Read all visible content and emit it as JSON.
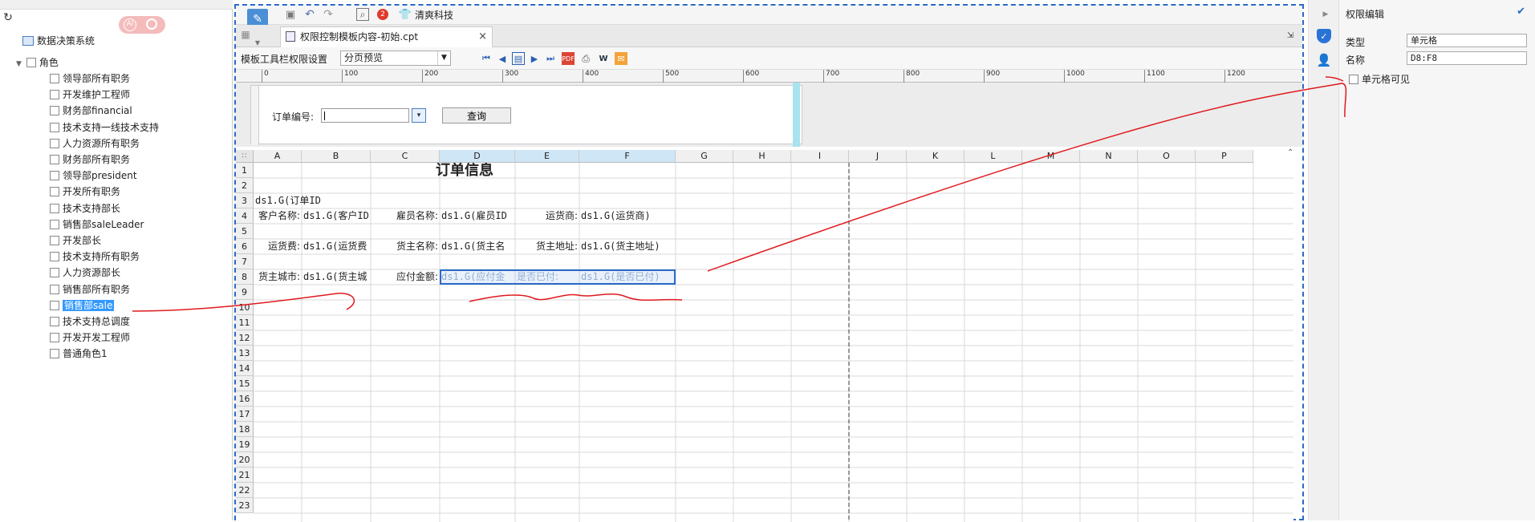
{
  "left_panel": {
    "system_label": "数据决策系统",
    "ai_label": "AI",
    "role_root": "角色",
    "roles": [
      "领导部所有职务",
      "开发维护工程师",
      "财务部financial",
      "技术支持一线技术支持",
      "人力资源所有职务",
      "财务部所有职务",
      "领导部president",
      "开发所有职务",
      "技术支持部长",
      "销售部saleLeader",
      "开发部长",
      "技术支持所有职务",
      "人力资源部长",
      "销售部所有职务",
      "销售部sale",
      "技术支持总调度",
      "开发开发工程师",
      "普通角色1"
    ],
    "selected_role": "销售部sale"
  },
  "designer": {
    "toolbar_brand": "清爽科技",
    "badge_count": "2",
    "tab_title": "权限控制模板内容-初始.cpt",
    "tab_close": "×",
    "toolbar2_label": "模板工具栏权限设置",
    "preview_mode": "分页预览",
    "ruler_ticks": [
      "0",
      "100",
      "200",
      "300",
      "400",
      "500",
      "600",
      "700",
      "800",
      "900",
      "1000",
      "1100",
      "1200"
    ],
    "param": {
      "label": "订单编号:",
      "query_button": "查询"
    },
    "columns": [
      "A",
      "B",
      "C",
      "D",
      "E",
      "F",
      "G",
      "H",
      "I",
      "J",
      "K",
      "L",
      "M",
      "N",
      "O",
      "P"
    ],
    "rows": [
      "1",
      "2",
      "3",
      "4",
      "5",
      "6",
      "7",
      "8",
      "9",
      "10",
      "11",
      "12",
      "13",
      "14",
      "15",
      "16",
      "17",
      "18",
      "19",
      "20",
      "21",
      "22",
      "23"
    ],
    "cells": {
      "title": "订单信息",
      "a3": "ds1.G(订单ID",
      "a4": "客户名称:",
      "b4": "ds1.G(客户ID",
      "c4": "雇员名称:",
      "d4": "ds1.G(雇员ID",
      "e4": "运货商:",
      "f4": "ds1.G(运货商)",
      "a6": "运货费:",
      "b6": "ds1.G(运货费",
      "c6": "货主名称:",
      "d6": "ds1.G(货主名",
      "e6": "货主地址:",
      "f6": "ds1.G(货主地址)",
      "a8": "货主城市:",
      "b8": "ds1.G(货主城",
      "c8": "应付金额:",
      "d8": "ds1.G(应付金",
      "e8": "是否已付:",
      "f8": "ds1.G(是否已付)"
    }
  },
  "right_panel": {
    "title": "权限编辑",
    "type_label": "类型",
    "type_value": "单元格",
    "name_label": "名称",
    "name_value": "D8:F8",
    "visible_label": "单元格可见"
  },
  "colors": {
    "accent": "#2a6ac8",
    "annotation": "#e0191f",
    "selected_bg": "#3399ff"
  }
}
